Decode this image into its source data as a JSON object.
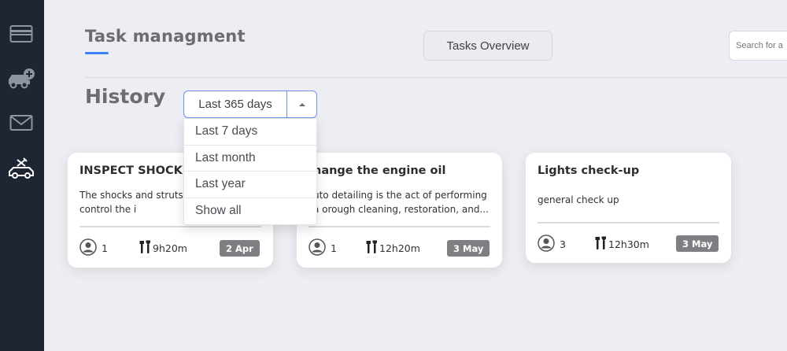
{
  "sidebar": {
    "items": [
      {
        "icon": "card-icon"
      },
      {
        "icon": "add-car-icon"
      },
      {
        "icon": "mail-icon"
      },
      {
        "icon": "car-repair-icon"
      }
    ]
  },
  "header": {
    "title": "Task managment",
    "tab_label": "Tasks Overview",
    "search_placeholder": "Search for a"
  },
  "history": {
    "label": "History",
    "selected": "Last 365 days",
    "options": [
      "Last 7 days",
      "Last month",
      "Last year",
      "Show all"
    ]
  },
  "tasks": [
    {
      "title": "INSPECT SHOCKS",
      "description": "The shocks and struts o function to control the i",
      "users": "1",
      "time": "9h20m",
      "date": "2 Apr"
    },
    {
      "title": "hange the engine oil",
      "description": "uto detailing is the act of performing a orough cleaning, restoration, and...",
      "users": "1",
      "time": "12h20m",
      "date": "3 May"
    },
    {
      "title": "Lights check-up",
      "description": "general check up",
      "users": "3",
      "time": "12h30m",
      "date": "3 May"
    }
  ],
  "colors": {
    "sidebar_bg": "#1f2633",
    "page_bg": "#eceef3",
    "accent": "#3b82f6",
    "badge_bg": "#7d7f82"
  }
}
